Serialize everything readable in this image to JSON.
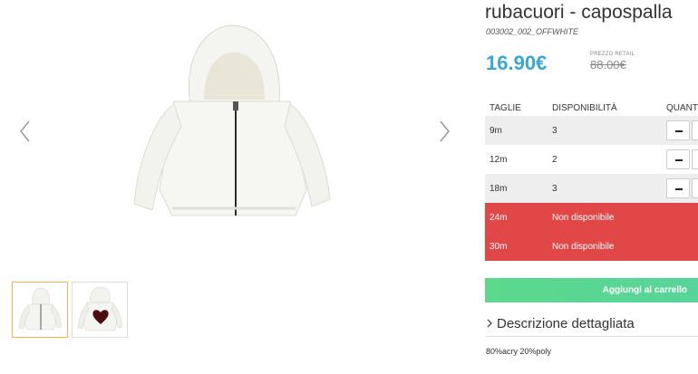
{
  "product": {
    "title": "rubacuori - capospalla",
    "sku": "003002_002_OFFWHITE",
    "price": "16.90€",
    "retail_label": "PREZZO RETAIL",
    "retail_price": "88.00€"
  },
  "sizes_table": {
    "headers": [
      "TAGLIE",
      "DISPONIBILITÀ",
      "QUANT"
    ],
    "rows": [
      {
        "size": "9m",
        "availability": "3",
        "state": "available"
      },
      {
        "size": "12m",
        "availability": "2",
        "state": "available"
      },
      {
        "size": "18m",
        "availability": "3",
        "state": "available"
      },
      {
        "size": "24m",
        "availability": "Non disponibile",
        "state": "unavailable"
      },
      {
        "size": "30m",
        "availability": "Non disponibile",
        "state": "unavailable"
      }
    ]
  },
  "cart": {
    "label": "Aggiungi al carrello"
  },
  "description": {
    "toggle_label": "Descrizione dettagliata",
    "text": "80%acry 20%poly"
  },
  "gallery": {
    "thumbnails": [
      "jacket-front",
      "jacket-back-heart"
    ],
    "active_thumbnail": 0
  },
  "colors": {
    "price": "#3aa6d6",
    "unavailable": "#e24747",
    "cart": "#5dd88c",
    "thumb_active_border": "#f0b458"
  }
}
